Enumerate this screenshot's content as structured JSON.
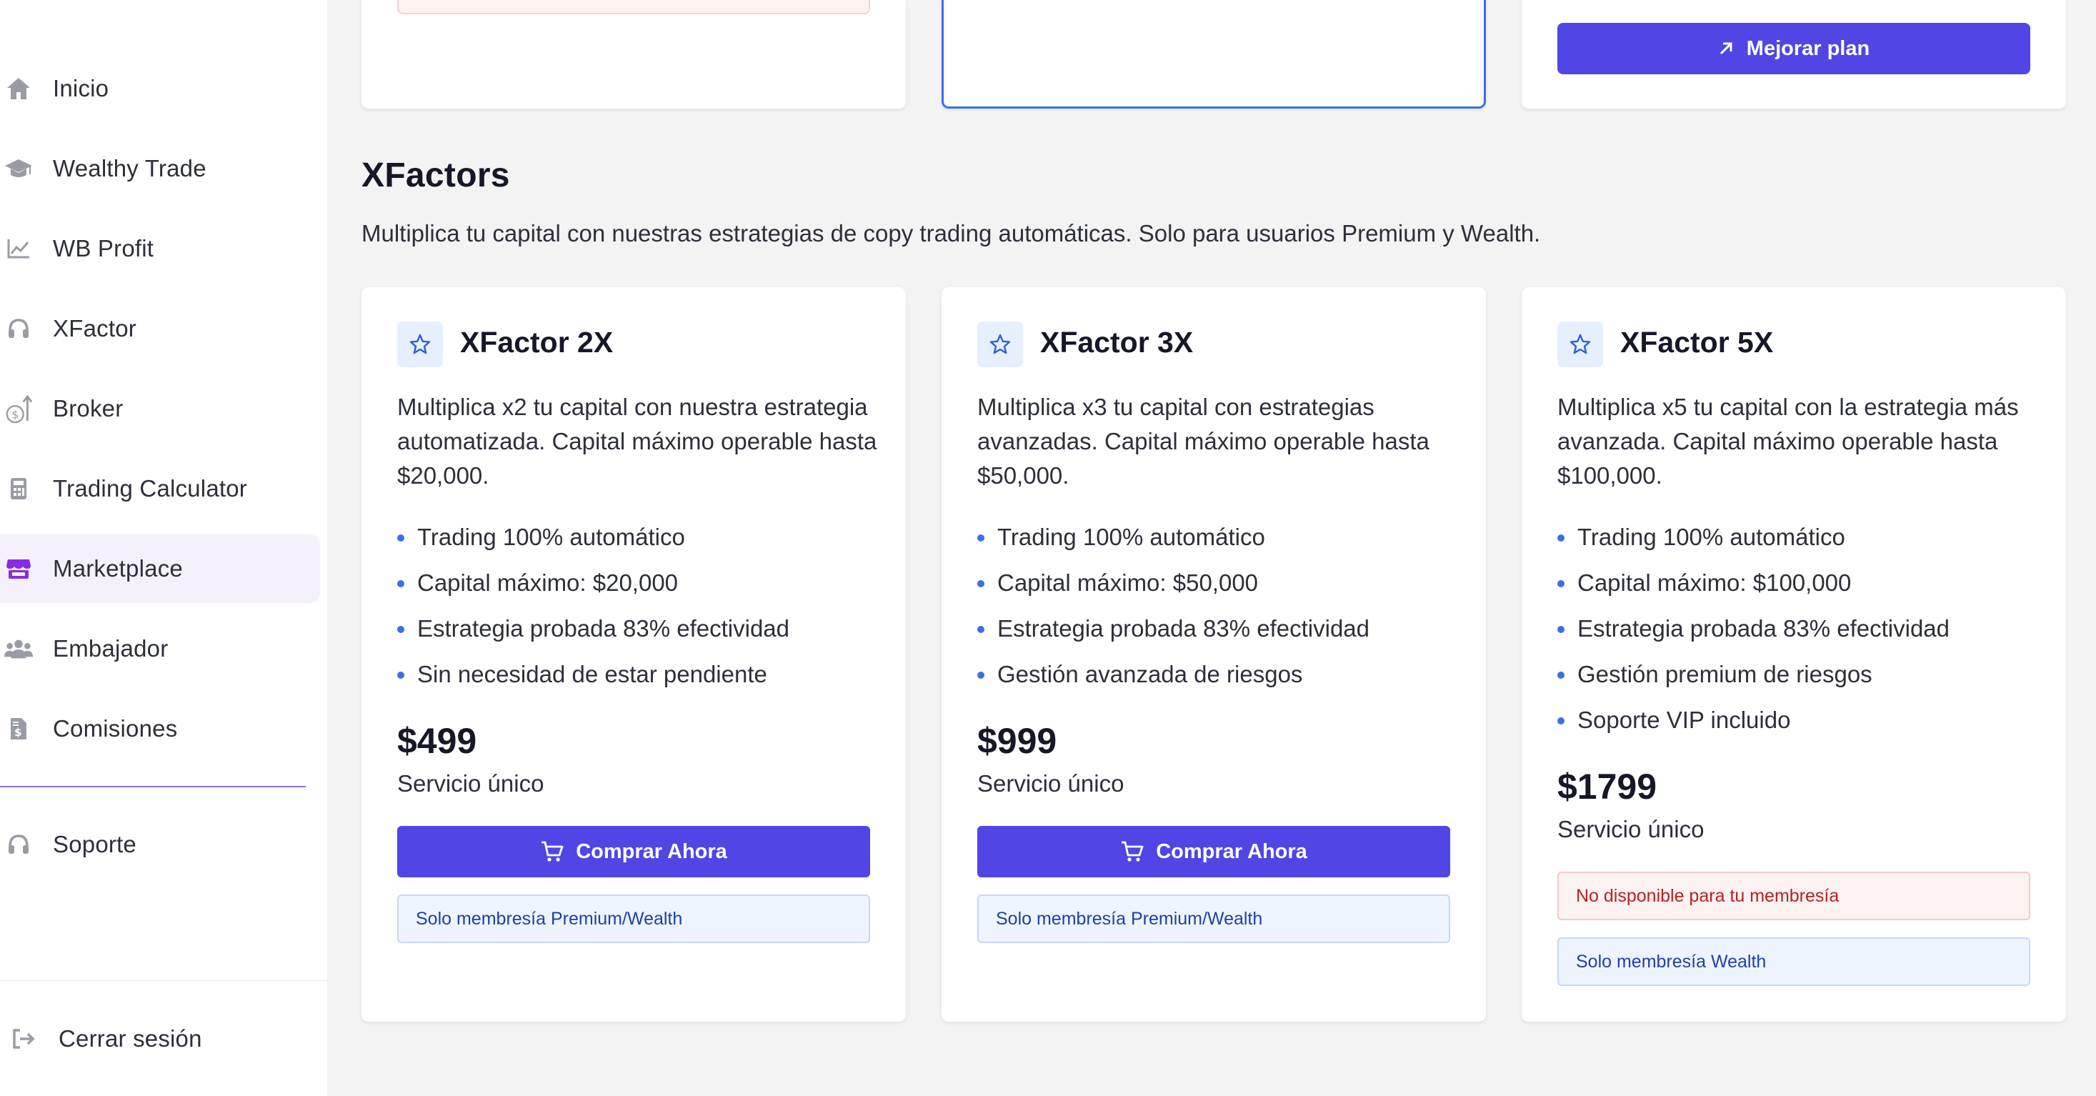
{
  "colors": {
    "accent": "#4f46e5",
    "bullet": "#3b6fe8",
    "active_nav_bg": "#f4f1fb",
    "info_bg": "#eef4fe",
    "warn_bg": "#fdf2f2"
  },
  "sidebar": {
    "items": [
      {
        "label": "Inicio",
        "icon": "home-icon"
      },
      {
        "label": "Wealthy Trade",
        "icon": "graduation-cap-icon"
      },
      {
        "label": "WB Profit",
        "icon": "line-chart-icon"
      },
      {
        "label": "XFactor",
        "icon": "headset-icon"
      },
      {
        "label": "Broker",
        "icon": "money-growth-icon"
      },
      {
        "label": "Trading Calculator",
        "icon": "calculator-icon"
      },
      {
        "label": "Marketplace",
        "icon": "store-icon",
        "active": true
      },
      {
        "label": "Embajador",
        "icon": "users-icon"
      },
      {
        "label": "Comisiones",
        "icon": "invoice-dollar-icon"
      }
    ],
    "support": {
      "label": "Soporte",
      "icon": "headset-icon"
    },
    "logout": {
      "label": "Cerrar sesión",
      "icon": "sign-out-icon"
    }
  },
  "top": {
    "upgrade_label": "Mejorar plan"
  },
  "section": {
    "title": "XFactors",
    "subtitle": "Multiplica tu capital con nuestras estrategias de copy trading automáticas. Solo para usuarios Premium y Wealth."
  },
  "cards": [
    {
      "title": "XFactor 2X",
      "description": "Multiplica x2 tu capital con nuestra estrategia automatizada. Capital máximo operable hasta $20,000.",
      "features": [
        "Trading 100% automático",
        "Capital máximo: $20,000",
        "Estrategia probada 83% efectividad",
        "Sin necesidad de estar pendiente"
      ],
      "price": "$499",
      "price_note": "Servicio único",
      "buy_label": "Comprar Ahora",
      "info": "Solo membresía Premium/Wealth"
    },
    {
      "title": "XFactor 3X",
      "description": "Multiplica x3 tu capital con estrategias avanzadas. Capital máximo operable hasta $50,000.",
      "features": [
        "Trading 100% automático",
        "Capital máximo: $50,000",
        "Estrategia probada 83% efectividad",
        "Gestión avanzada de riesgos"
      ],
      "price": "$999",
      "price_note": "Servicio único",
      "buy_label": "Comprar Ahora",
      "info": "Solo membresía Premium/Wealth"
    },
    {
      "title": "XFactor 5X",
      "description": "Multiplica x5 tu capital con la estrategia más avanzada. Capital máximo operable hasta $100,000.",
      "features": [
        "Trading 100% automático",
        "Capital máximo: $100,000",
        "Estrategia probada 83% efectividad",
        "Gestión premium de riesgos",
        "Soporte VIP incluido"
      ],
      "price": "$1799",
      "price_note": "Servicio único",
      "warning": "No disponible para tu membresía",
      "info": "Solo membresía Wealth"
    }
  ]
}
